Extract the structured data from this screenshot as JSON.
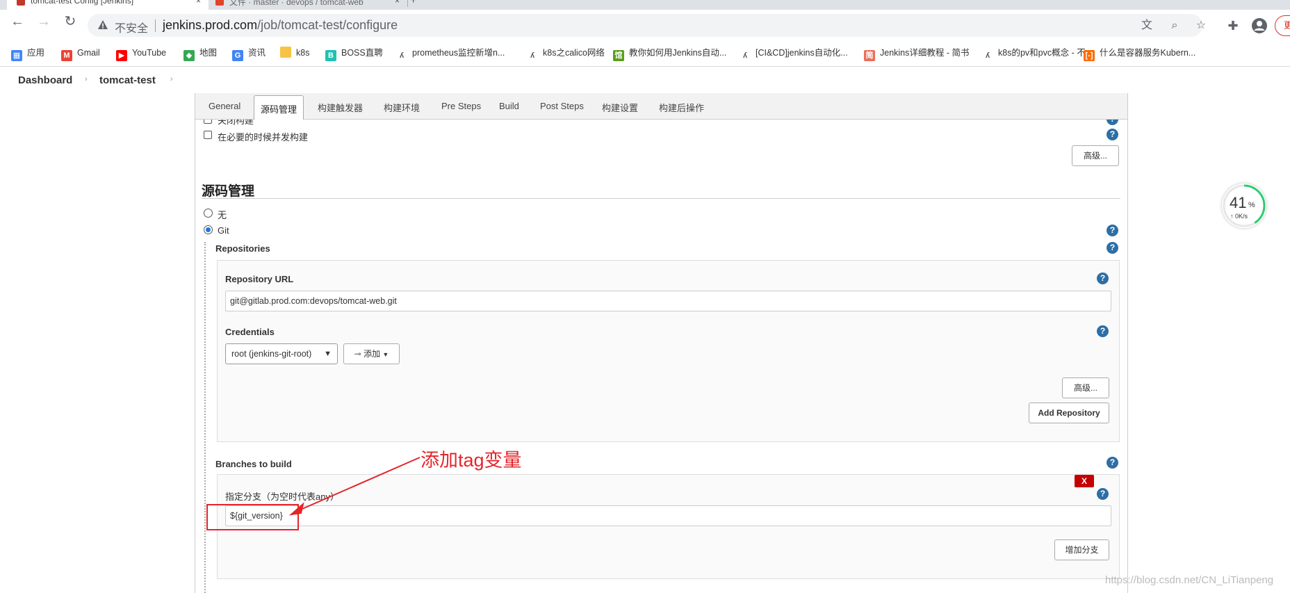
{
  "browser": {
    "tabs": [
      {
        "title": "tomcat-test Config [Jenkins]",
        "close": "×"
      },
      {
        "title": "文件 · master · devops / tomcat-web",
        "close": "×"
      }
    ],
    "new_tab": "+",
    "security_label": "不安全",
    "url_host": "jenkins.prod.com",
    "url_path": "/job/tomcat-test/configure",
    "profile_label": "更"
  },
  "bookmarks": [
    {
      "label": "应用",
      "icon": "apps-grid-icon",
      "color": "#4285f4"
    },
    {
      "label": "Gmail",
      "icon": "gmail-icon",
      "color": "#ea4335"
    },
    {
      "label": "YouTube",
      "icon": "youtube-icon",
      "color": "#ff0000"
    },
    {
      "label": "地图",
      "icon": "maps-icon",
      "color": "#34a853"
    },
    {
      "label": "资讯",
      "icon": "news-icon",
      "color": "#4285f4"
    },
    {
      "label": "k8s",
      "icon": "folder-icon",
      "color": "#f6c344"
    },
    {
      "label": "BOSS直聘",
      "icon": "boss-icon",
      "color": "#21c1b0"
    },
    {
      "label": "prometheus监控新增n...",
      "icon": "blog-icon",
      "color": "#555555"
    },
    {
      "label": "k8s之calico网络",
      "icon": "blog-icon",
      "color": "#555555"
    },
    {
      "label": "教你如何用Jenkins自动...",
      "icon": "green-site-icon",
      "color": "#5a9e1a"
    },
    {
      "label": "[CI&CD]jenkins自动化...",
      "icon": "blog-icon",
      "color": "#555555"
    },
    {
      "label": "Jenkins详细教程 - 简书",
      "icon": "jianshu-icon",
      "color": "#ea6f5a"
    },
    {
      "label": "k8s的pv和pvc概念 - 不...",
      "icon": "blog-icon",
      "color": "#555555"
    },
    {
      "label": "什么是容器服务Kubern...",
      "icon": "aliyun-icon",
      "color": "#ff6a00"
    }
  ],
  "breadcrumb": {
    "items": [
      "Dashboard",
      "tomcat-test"
    ],
    "separator": "›"
  },
  "config_tabs": [
    "General",
    "源码管理",
    "构建触发器",
    "构建环境",
    "Pre Steps",
    "Build",
    "Post Steps",
    "构建设置",
    "构建后操作"
  ],
  "top_options": {
    "partial_label": "关闭构建",
    "concurrent_label": "在必要的时候并发构建",
    "advanced_button": "高级..."
  },
  "scm": {
    "title": "源码管理",
    "none_label": "无",
    "git_label": "Git",
    "repositories_label": "Repositories",
    "repo_url_label": "Repository URL",
    "repo_url_value": "git@gitlab.prod.com:devops/tomcat-web.git",
    "credentials_label": "Credentials",
    "credentials_selected": "root (jenkins-git-root)",
    "add_button": "添加",
    "repo_advanced_button": "高级...",
    "add_repository_button": "Add Repository",
    "branches_label": "Branches to build",
    "branch_specifier_label": "指定分支（为空时代表any）",
    "branch_specifier_value": "${git_version}",
    "delete_button": "X",
    "add_branch_button": "增加分支"
  },
  "annotation": {
    "text": "添加tag变量",
    "color": "#e5242a"
  },
  "speed_widget": {
    "percent": "41",
    "percent_sign": "%",
    "rate": "↑ 0K/s",
    "progress": 0.41
  },
  "watermark": "https://blog.csdn.net/CN_LiTianpeng",
  "help_symbol": "?"
}
